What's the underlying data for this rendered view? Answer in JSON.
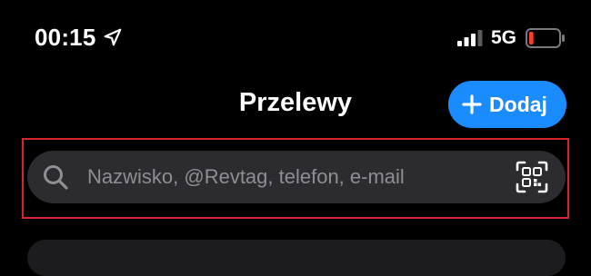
{
  "status_bar": {
    "time": "00:15",
    "network": "5G",
    "icons": [
      "location-arrow-icon",
      "signal-bars-icon",
      "battery-low-icon"
    ],
    "battery_level": 0.15
  },
  "header": {
    "title": "Przelewy",
    "add_button_label": "Dodaj"
  },
  "search": {
    "placeholder": "Nazwisko, @Revtag, telefon, e-mail",
    "value": "",
    "icons": [
      "search-icon",
      "qr-code-scan-icon"
    ]
  },
  "colors": {
    "background": "#000000",
    "accent": "#1a8cff",
    "search_bg": "#2b2b30",
    "placeholder": "#8e8e93",
    "highlight": "#d8232a",
    "battery": "#ff3b30"
  }
}
